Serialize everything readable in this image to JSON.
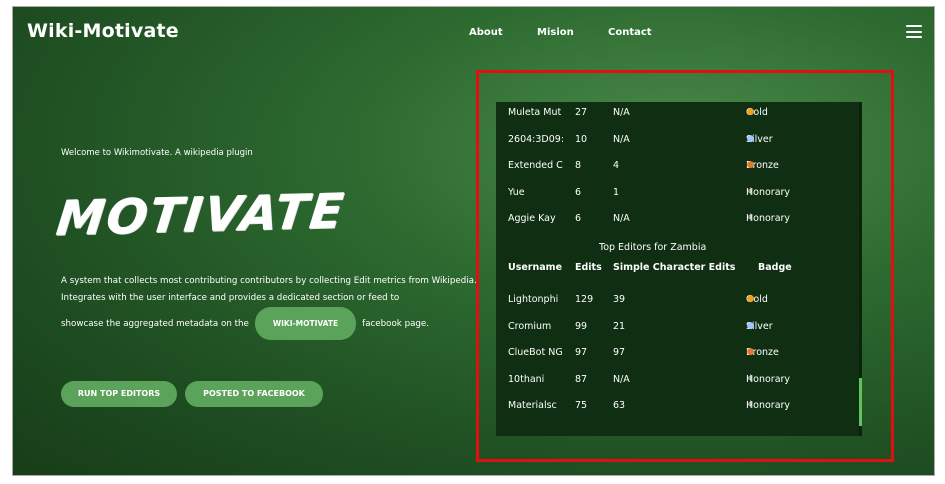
{
  "brand": "Wiki-Motivate",
  "nav": {
    "about": "About",
    "mision": "Mision",
    "contact": "Contact"
  },
  "hero": {
    "welcome": "Welcome to Wikimotivate. A wikipedia plugin",
    "title": "MOTIVATE",
    "desc_line1": "A system that collects most contributing contributors by collecting Edit metrics from Wikipedia.",
    "desc_line2": "Integrates with the user interface and provides a dedicated section or feed to",
    "desc_line3_pre": "showcase the aggregated metadata on the",
    "desc_pill": "WIKI-MOTIVATE",
    "desc_line3_post": "facebook page."
  },
  "buttons": {
    "run": "RUN TOP EDITORS",
    "posted": "POSTED TO FACEBOOK"
  },
  "panel": {
    "prev_rows": [
      {
        "username": "Muleta Mut",
        "edits": "27",
        "chars": "N/A",
        "badge": "Gold",
        "medal": "gold"
      },
      {
        "username": "2604:3D09:",
        "edits": "10",
        "chars": "N/A",
        "badge": "Silver",
        "medal": "silver"
      },
      {
        "username": "Extended C",
        "edits": "8",
        "chars": "4",
        "badge": "Bronze",
        "medal": "bronze"
      },
      {
        "username": "Yue",
        "edits": "6",
        "chars": "1",
        "badge": "Honorary",
        "medal": "hon"
      },
      {
        "username": "Aggie Kay",
        "edits": "6",
        "chars": "N/A",
        "badge": "Honorary",
        "medal": "hon"
      }
    ],
    "zambia_title": "Top Editors for Zambia",
    "headers": {
      "username": "Username",
      "edits": "Edits",
      "chars": "Simple Character Edits",
      "badge": "Badge"
    },
    "zambia_rows": [
      {
        "username": "Lightonphi",
        "edits": "129",
        "chars": "39",
        "badge": "Gold",
        "medal": "gold"
      },
      {
        "username": "Cromium",
        "edits": "99",
        "chars": "21",
        "badge": "Silver",
        "medal": "silver"
      },
      {
        "username": "ClueBot NG",
        "edits": "97",
        "chars": "97",
        "badge": "Bronze",
        "medal": "bronze"
      },
      {
        "username": "10thani",
        "edits": "87",
        "chars": "N/A",
        "badge": "Honorary",
        "medal": "hon"
      },
      {
        "username": "Materialsc",
        "edits": "75",
        "chars": "63",
        "badge": "Honorary",
        "medal": "hon"
      }
    ]
  }
}
